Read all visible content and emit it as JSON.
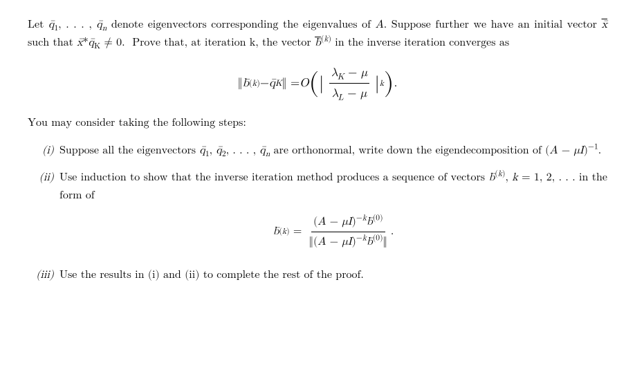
{
  "page": {
    "intro_paragraph": "Let  denote eigenvectors corresponding the eigenvalues of A. Suppose further we have an initial vector  such that  ≠ 0.  Prove that, at iteration k, the vector  in the inverse iteration converges as",
    "you_may": "You may consider taking the following steps:",
    "step_i_label": "(i)",
    "step_i_text": "Suppose all the eigenvectors  are orthonormal, write down the eigendecomposition of (A − μI)⁻¹.",
    "step_ii_label": "(ii)",
    "step_ii_text": "Use induction to show that the inverse iteration method produces a sequence of vectors , k = 1, 2, . . . in the form of",
    "step_iii_label": "(iii)",
    "step_iii_text": "Use the results in (i) and (ii) to complete the rest of the proof."
  }
}
